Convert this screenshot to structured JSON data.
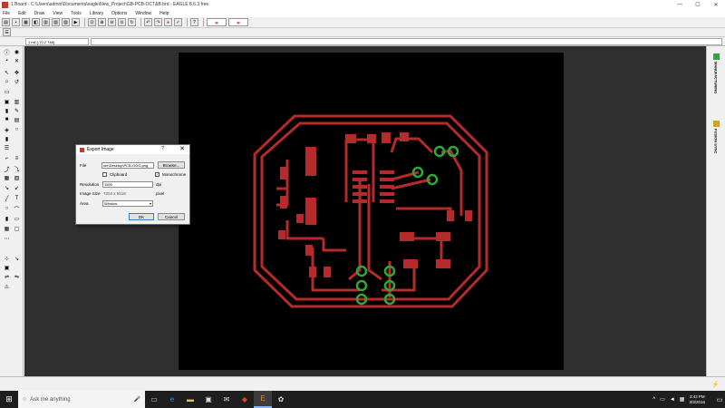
{
  "window": {
    "title": "1 Board - C:\\Users\\admin\\Documents\\eagle\\New_Project\\GB-PCB-OCT&B.brd - EAGLE 8.6.3 free",
    "min": "—",
    "max": "☐",
    "close": "✕"
  },
  "menu": [
    "File",
    "Edit",
    "Draw",
    "View",
    "Tools",
    "Library",
    "Options",
    "Window",
    "Help"
  ],
  "coord_display": "1 mil (-70.2 748)",
  "right_tabs": {
    "manufacturing": "MANUFACTURING",
    "fusion_sync": "FUSION SYNC"
  },
  "dialog": {
    "title": "Export Image",
    "help": "?",
    "close": "✕",
    "file_label": "File",
    "file_value": "ser\\Desktop\\PCB-OGG.png",
    "browse_label": "Browse...",
    "clipboard_label": "Clipboard",
    "monochrome_label": "Monochrome",
    "monochrome_checked": "✓",
    "resolution_label": "Resolution",
    "resolution_value": "1500",
    "resolution_unit": "dpi",
    "image_size_label": "Image Size",
    "image_size_value": "7204 x 5518",
    "image_size_unit": "pixel",
    "area_label": "Area",
    "area_value": "Window",
    "ok_label": "OK",
    "cancel_label": "Cancel"
  },
  "taskbar": {
    "search_placeholder": "Ask me anything",
    "time": "3:43 PM",
    "date": "3/3/2016"
  },
  "colors": {
    "trace": "#b52a2a",
    "pad": "#2fa83a",
    "board_bg": "#000000",
    "canvas_bg": "#2f2f2f"
  }
}
